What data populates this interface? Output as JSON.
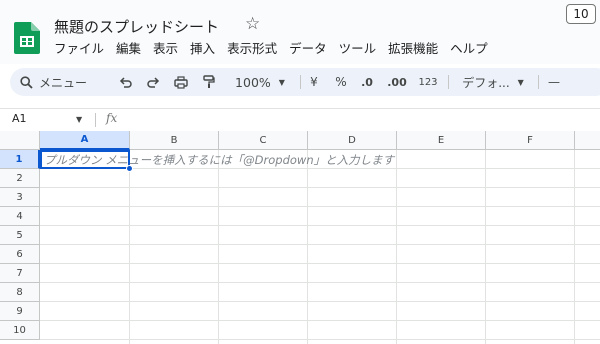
{
  "document": {
    "title": "無題のスプレッドシート"
  },
  "menubar": {
    "items": [
      "ファイル",
      "編集",
      "表示",
      "挿入",
      "表示形式",
      "データ",
      "ツール",
      "拡張機能",
      "ヘルプ"
    ]
  },
  "toolbar": {
    "search_label": "メニュー",
    "zoom": "100%",
    "currency_label": "¥",
    "percent_label": "%",
    "decrease_decimal_label": ".0",
    "increase_decimal_label": ".00",
    "number_format_label": "123",
    "font_label": "デフォ...",
    "font_size_decrease_label": "—",
    "font_size": "10"
  },
  "formula_bar": {
    "name_box": "A1",
    "fx_label": "fx"
  },
  "grid": {
    "columns": [
      "A",
      "B",
      "C",
      "D",
      "E",
      "F"
    ],
    "rows": [
      "1",
      "2",
      "3",
      "4",
      "5",
      "6",
      "7",
      "8",
      "9",
      "10"
    ],
    "selected_column": "A",
    "selected_row": "1",
    "active_cell_hint": "プルダウン メニューを挿入するには「@Dropdown」と入力します"
  },
  "colors": {
    "accent": "#0b57d0",
    "selected_header": "#d3e3fd",
    "sheets_green": "#0f9d58",
    "toolbar_bg": "#edf2fa"
  }
}
